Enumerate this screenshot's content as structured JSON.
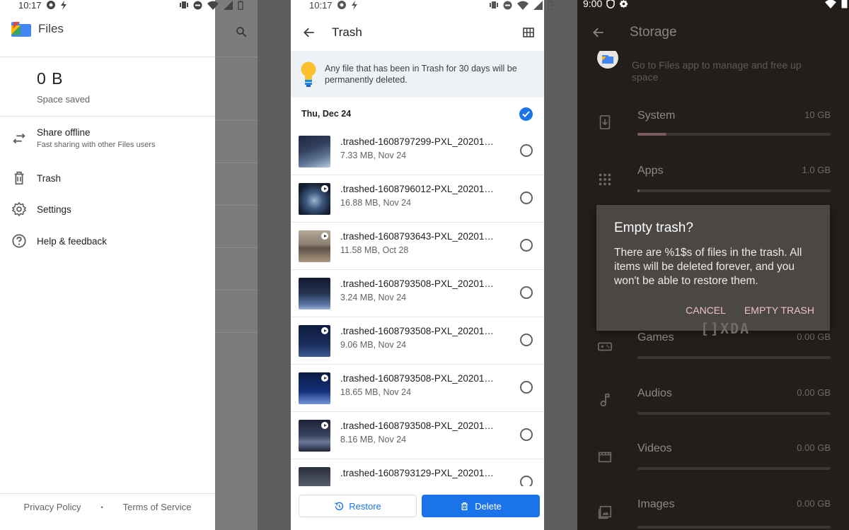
{
  "colors": {
    "accent": "#1a73e8",
    "dark_bg": "#221e1b",
    "dialog_action": "#f2c1c6"
  },
  "panel1": {
    "status_time": "10:17",
    "app_title": "Files",
    "saved_value": "0 B",
    "saved_label": "Space saved",
    "menu": [
      {
        "label": "Share offline",
        "sub": "Fast sharing with other Files users",
        "icon": "swap-icon"
      },
      {
        "label": "Trash",
        "icon": "trash-icon"
      },
      {
        "label": "Settings",
        "icon": "gear-icon"
      },
      {
        "label": "Help & feedback",
        "icon": "help-icon"
      }
    ],
    "footer": {
      "privacy": "Privacy Policy",
      "dot": "•",
      "terms": "Terms of Service"
    }
  },
  "panel2": {
    "status_time": "10:17",
    "title": "Trash",
    "banner": "Any file that has been in Trash for 30 days will be permanently deleted.",
    "date_header": "Thu, Dec 24",
    "files": [
      {
        "name": ".trashed-1608797299-PXL_20201…",
        "meta": "7.33 MB, Nov 24"
      },
      {
        "name": ".trashed-1608796012-PXL_20201…",
        "meta": "16.88 MB, Nov 24"
      },
      {
        "name": ".trashed-1608793643-PXL_20201…",
        "meta": "11.58 MB, Oct 28"
      },
      {
        "name": ".trashed-1608793508-PXL_20201…",
        "meta": "3.24 MB, Nov 24"
      },
      {
        "name": ".trashed-1608793508-PXL_20201…",
        "meta": "9.06 MB, Nov 24"
      },
      {
        "name": ".trashed-1608793508-PXL_20201…",
        "meta": "18.65 MB, Nov 24"
      },
      {
        "name": ".trashed-1608793508-PXL_20201…",
        "meta": "8.16 MB, Nov 24"
      },
      {
        "name": ".trashed-1608793129-PXL_20201…",
        "meta": ""
      }
    ],
    "restore_label": "Restore",
    "delete_label": "Delete"
  },
  "panel3": {
    "status_time": "9:00",
    "title": "Storage",
    "top_hint": "Go to Files app to manage and free up space",
    "items": [
      {
        "name": "System",
        "size": "10 GB",
        "usage": 0.15,
        "icon": "download-icon"
      },
      {
        "name": "Apps",
        "size": "1.0 GB",
        "usage": 0.01,
        "icon": "apps-grid-icon"
      },
      {
        "name": "Games",
        "size": "0.00 GB",
        "usage": 0,
        "icon": "gamepad-icon"
      },
      {
        "name": "Audios",
        "size": "0.00 GB",
        "usage": 0,
        "icon": "music-note-icon"
      },
      {
        "name": "Videos",
        "size": "0.00 GB",
        "usage": 0,
        "icon": "film-icon"
      },
      {
        "name": "Images",
        "size": "0.00 GB",
        "usage": 0,
        "icon": "image-icon"
      }
    ],
    "dialog": {
      "title": "Empty trash?",
      "message": "There are %1$s of files in the trash. All items will be deleted forever, and you won't be able to restore them.",
      "cancel": "CANCEL",
      "confirm": "EMPTY TRASH"
    },
    "watermark": "[]XDA"
  }
}
